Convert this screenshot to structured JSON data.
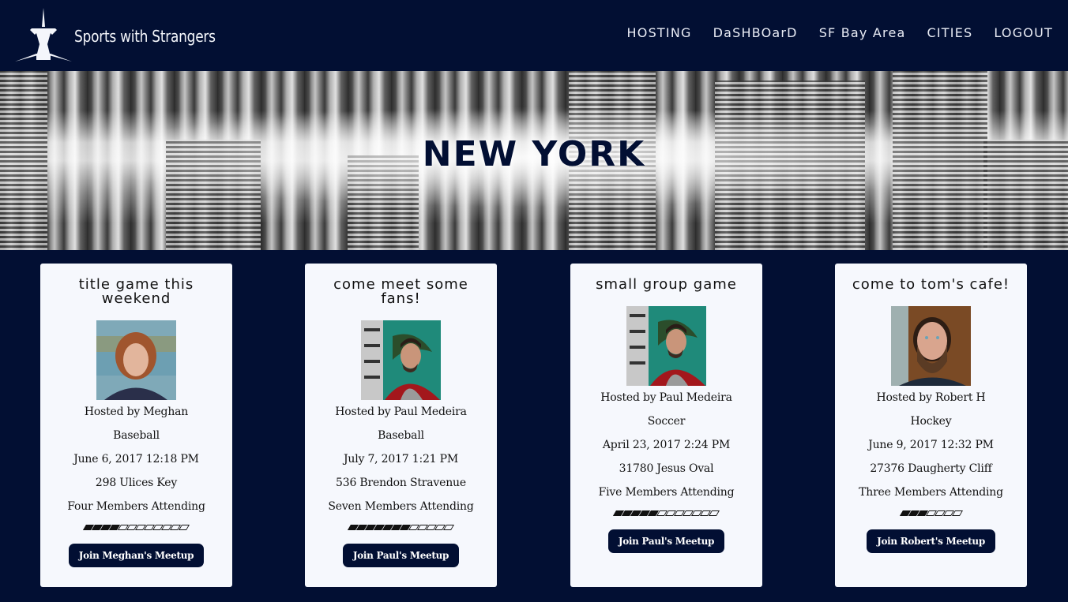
{
  "header": {
    "brand": "Sports with Strangers",
    "nav": [
      {
        "label": "HOSTING"
      },
      {
        "label": "DaSHBOarD"
      },
      {
        "label": "SF Bay Area"
      },
      {
        "label": "CITIES"
      },
      {
        "label": "LOGOUT"
      }
    ]
  },
  "banner": {
    "city": "NEW YORK"
  },
  "colors": {
    "navy": "#020f33",
    "card_bg": "#f6f8fd"
  },
  "meetups": [
    {
      "title": "Title Game This Weekend",
      "host": "Hosted by Meghan",
      "sport": "Baseball",
      "datetime": "June 6, 2017 12:18 PM",
      "address": "298 Ulices Key",
      "attendance": "Four Members Attending",
      "attending": 4,
      "capacity": 12,
      "button": "Join Meghan's Meetup",
      "avatar": "woman-red-hair"
    },
    {
      "title": "Come Meet Some Fans!",
      "host": "Hosted by Paul Medeira",
      "sport": "Baseball",
      "datetime": "July 7, 2017 1:21 PM",
      "address": "536 Brendon Stravenue",
      "attendance": "Seven Members Attending",
      "attending": 7,
      "capacity": 12,
      "button": "Join Paul's Meetup",
      "avatar": "man-glasses-graffiti"
    },
    {
      "title": "Small Group Game",
      "host": "Hosted by Paul Medeira",
      "sport": "Soccer",
      "datetime": "April 23, 2017 2:24 PM",
      "address": "31780 Jesus Oval",
      "attendance": "Five Members Attending",
      "attending": 5,
      "capacity": 12,
      "button": "Join Paul's Meetup",
      "avatar": "man-glasses-graffiti"
    },
    {
      "title": "Come to Tom's Cafe!",
      "host": "Hosted by Robert H",
      "sport": "Hockey",
      "datetime": "June 9, 2017 12:32 PM",
      "address": "27376 Daugherty Cliff",
      "attendance": "Three Members Attending",
      "attending": 3,
      "capacity": 7,
      "button": "Join Robert's Meetup",
      "avatar": "man-beard"
    }
  ]
}
